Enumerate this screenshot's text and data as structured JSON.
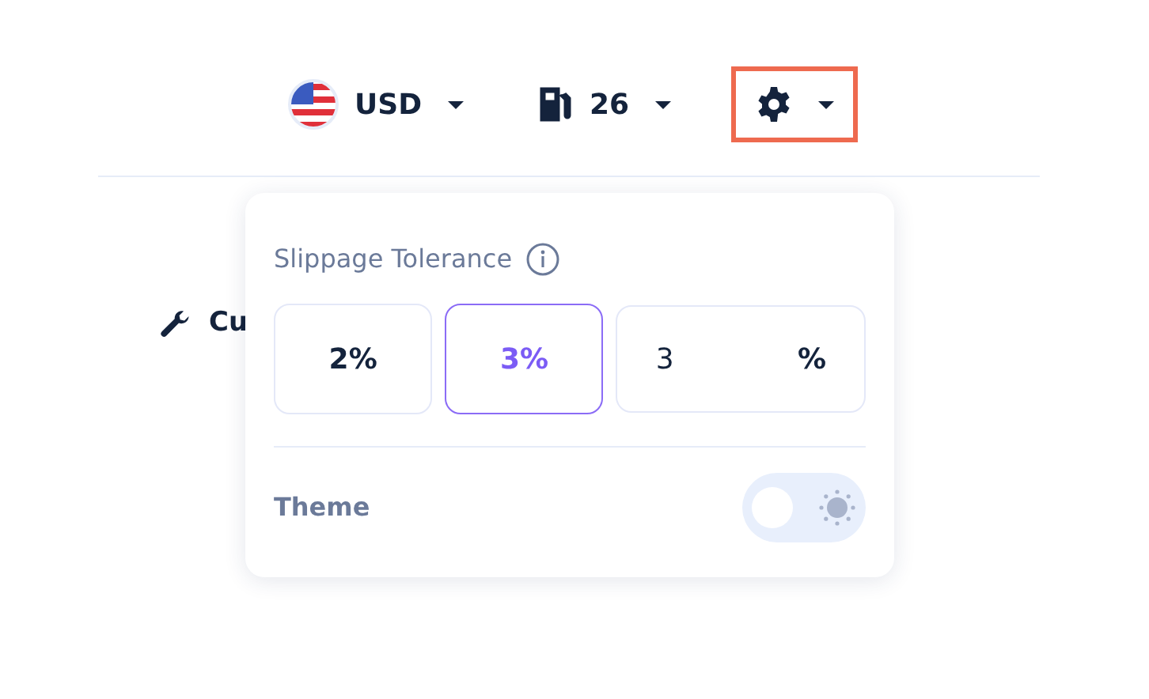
{
  "navbar": {
    "currency": {
      "label": "USD"
    },
    "gas": {
      "label": "26"
    },
    "settings": {
      "highlighted": true
    }
  },
  "behind": {
    "label": "Cu"
  },
  "settings_menu": {
    "slippage": {
      "title": "Slippage Tolerance",
      "options": [
        {
          "kind": "preset",
          "label": "2%",
          "selected": false
        },
        {
          "kind": "preset",
          "label": "3%",
          "selected": true
        },
        {
          "kind": "custom",
          "value": "3",
          "suffix": "%",
          "selected": false
        }
      ]
    },
    "theme": {
      "label": "Theme",
      "on": false
    }
  }
}
